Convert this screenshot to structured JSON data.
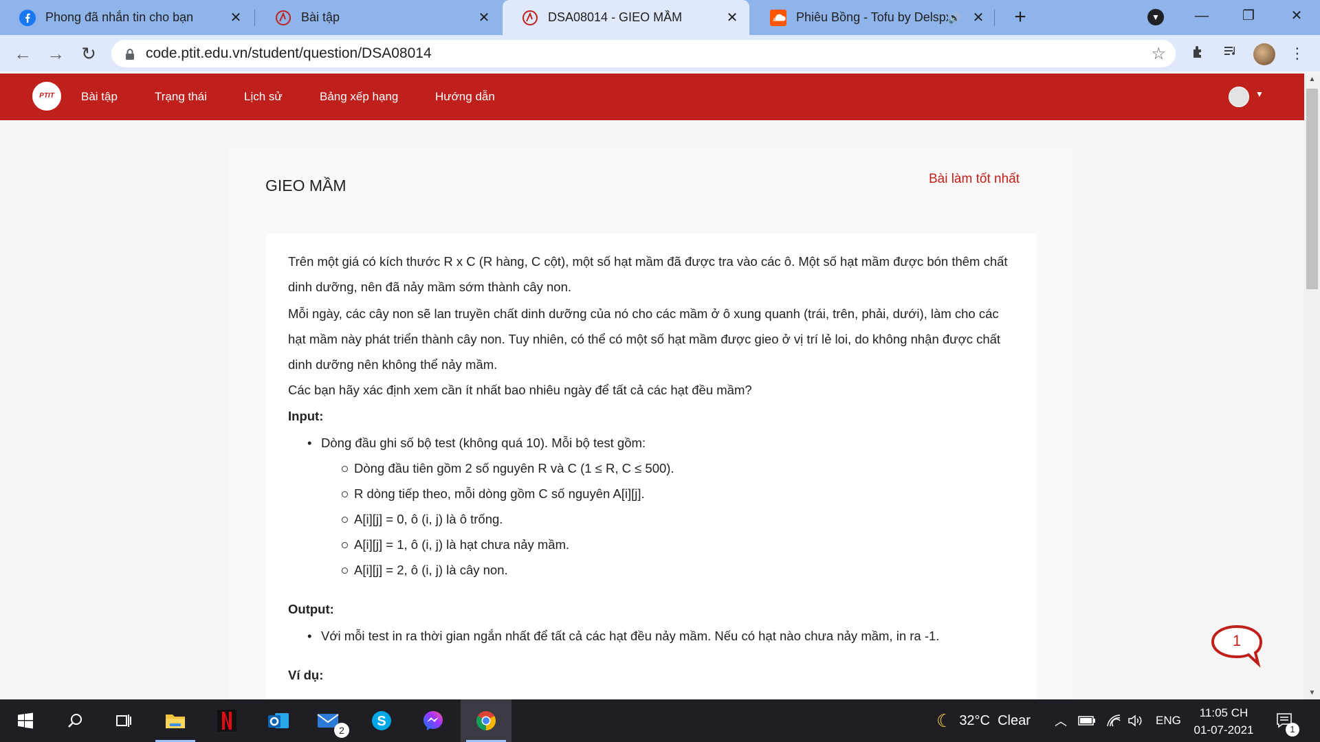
{
  "browser": {
    "tabs": [
      {
        "title": "Phong đã nhắn tin cho bạn",
        "icon": "facebook-icon",
        "active": false
      },
      {
        "title": "Bài tập",
        "icon": "ptit-icon",
        "active": false
      },
      {
        "title": "DSA08014 - GIEO MẦM",
        "icon": "ptit-icon",
        "active": true
      },
      {
        "title": "Phiêu Bồng - Tofu by Delspx",
        "icon": "soundcloud-icon",
        "active": false
      }
    ],
    "url": "code.ptit.edu.vn/student/question/DSA08014"
  },
  "site": {
    "logo_text": "PTIT",
    "nav": [
      "Bài tập",
      "Trạng thái",
      "Lịch sử",
      "Bảng xếp hạng",
      "Hướng dẫn"
    ],
    "accent": "#c0201c"
  },
  "problem": {
    "title": "GIEO MẦM",
    "best_link": "Bài làm tốt nhất",
    "para1": "Trên một giá có kích thước R x C (R hàng, C cột), một số hạt mầm đã được tra vào các ô. Một số hạt mầm được bón thêm chất dinh dưỡng, nên đã nảy mầm sớm thành cây non.",
    "para2": "Mỗi ngày, các cây non sẽ lan truyền chất dinh dưỡng của nó cho các mầm ở ô xung quanh (trái, trên, phải, dưới), làm cho các hạt mầm này phát triển thành cây non. Tuy nhiên, có thể có một số hạt mầm được gieo ở vị trí lẻ loi, do không nhận được chất dinh dưỡng nên không thể nảy mầm.",
    "para3": "Các bạn hãy xác định xem cần ít nhất bao nhiêu ngày để tất cả các hạt đều mầm?",
    "input_heading": "Input:",
    "input_item": "Dòng đầu ghi số bộ test (không quá 10). Mỗi bộ test gồm:",
    "input_sub": [
      "Dòng đầu tiên gồm 2 số nguyên R và C (1 ≤ R, C ≤ 500).",
      "R dòng tiếp theo, mỗi dòng gồm C số nguyên A[i][j].",
      "A[i][j] = 0, ô (i, j) là ô trống.",
      "A[i][j] = 1, ô (i, j) là hạt chưa nảy mầm.",
      "A[i][j] = 2, ô (i, j) là cây non."
    ],
    "output_heading": "Output:",
    "output_item": "Với mỗi test in ra thời gian ngắn nhất để tất cả các hạt đều nảy mầm. Nếu có hạt nào chưa nảy mầm, in ra -1.",
    "example_heading": "Ví dụ:"
  },
  "chat": {
    "count": "1"
  },
  "taskbar": {
    "mail_badge": "2",
    "weather": "32°C  Clear",
    "lang": "ENG",
    "time": "11:05 CH",
    "date": "01-07-2021",
    "notif_count": "1"
  }
}
